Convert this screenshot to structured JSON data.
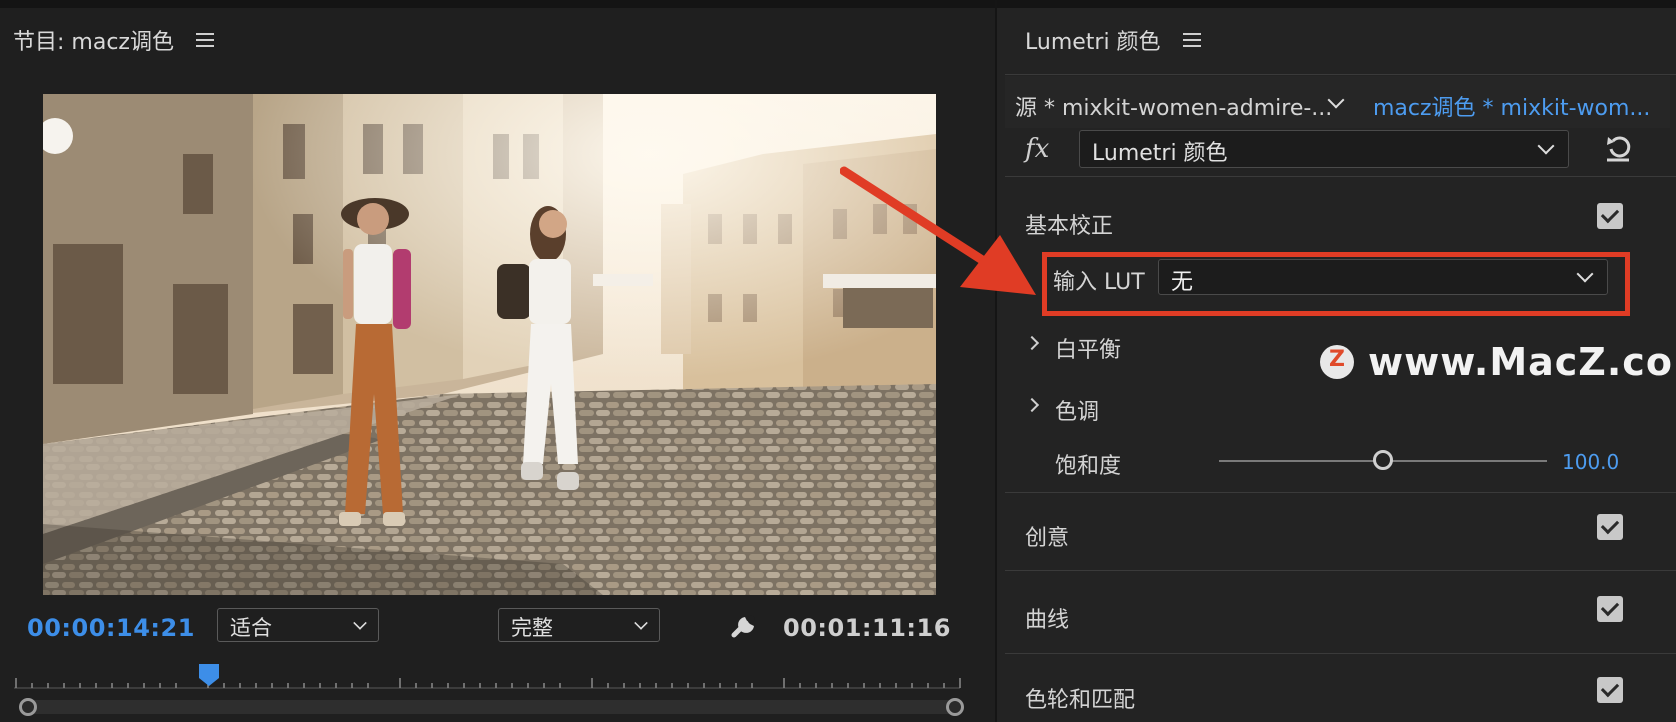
{
  "program_monitor": {
    "title": "节目: macz调色",
    "current_timecode": "00:00:14:21",
    "duration_timecode": "00:01:11:16",
    "zoom_dropdown": "适合",
    "quality_dropdown": "完整"
  },
  "lumetri": {
    "title": "Lumetri 颜色",
    "source_tab": "源 * mixkit-women-admire-...",
    "sequence_tab": "macz调色 * mixkit-wom...",
    "fx_label": "fx",
    "effect_select": "Lumetri 颜色",
    "basic_correction": {
      "label": "基本校正",
      "checked": true,
      "input_lut_label": "输入 LUT",
      "input_lut_value": "无",
      "white_balance": "白平衡",
      "tone": "色调",
      "saturation_label": "饱和度",
      "saturation_value": "100.0"
    },
    "sections": [
      {
        "label": "创意",
        "checked": true
      },
      {
        "label": "曲线",
        "checked": true
      },
      {
        "label": "色轮和匹配",
        "checked": true
      }
    ]
  },
  "watermark": {
    "logo": "Z",
    "text": "www.MacZ.com"
  },
  "colors": {
    "accent_blue": "#3d8ee8",
    "highlight_red": "#e03c25",
    "panel_bg": "#232323"
  }
}
